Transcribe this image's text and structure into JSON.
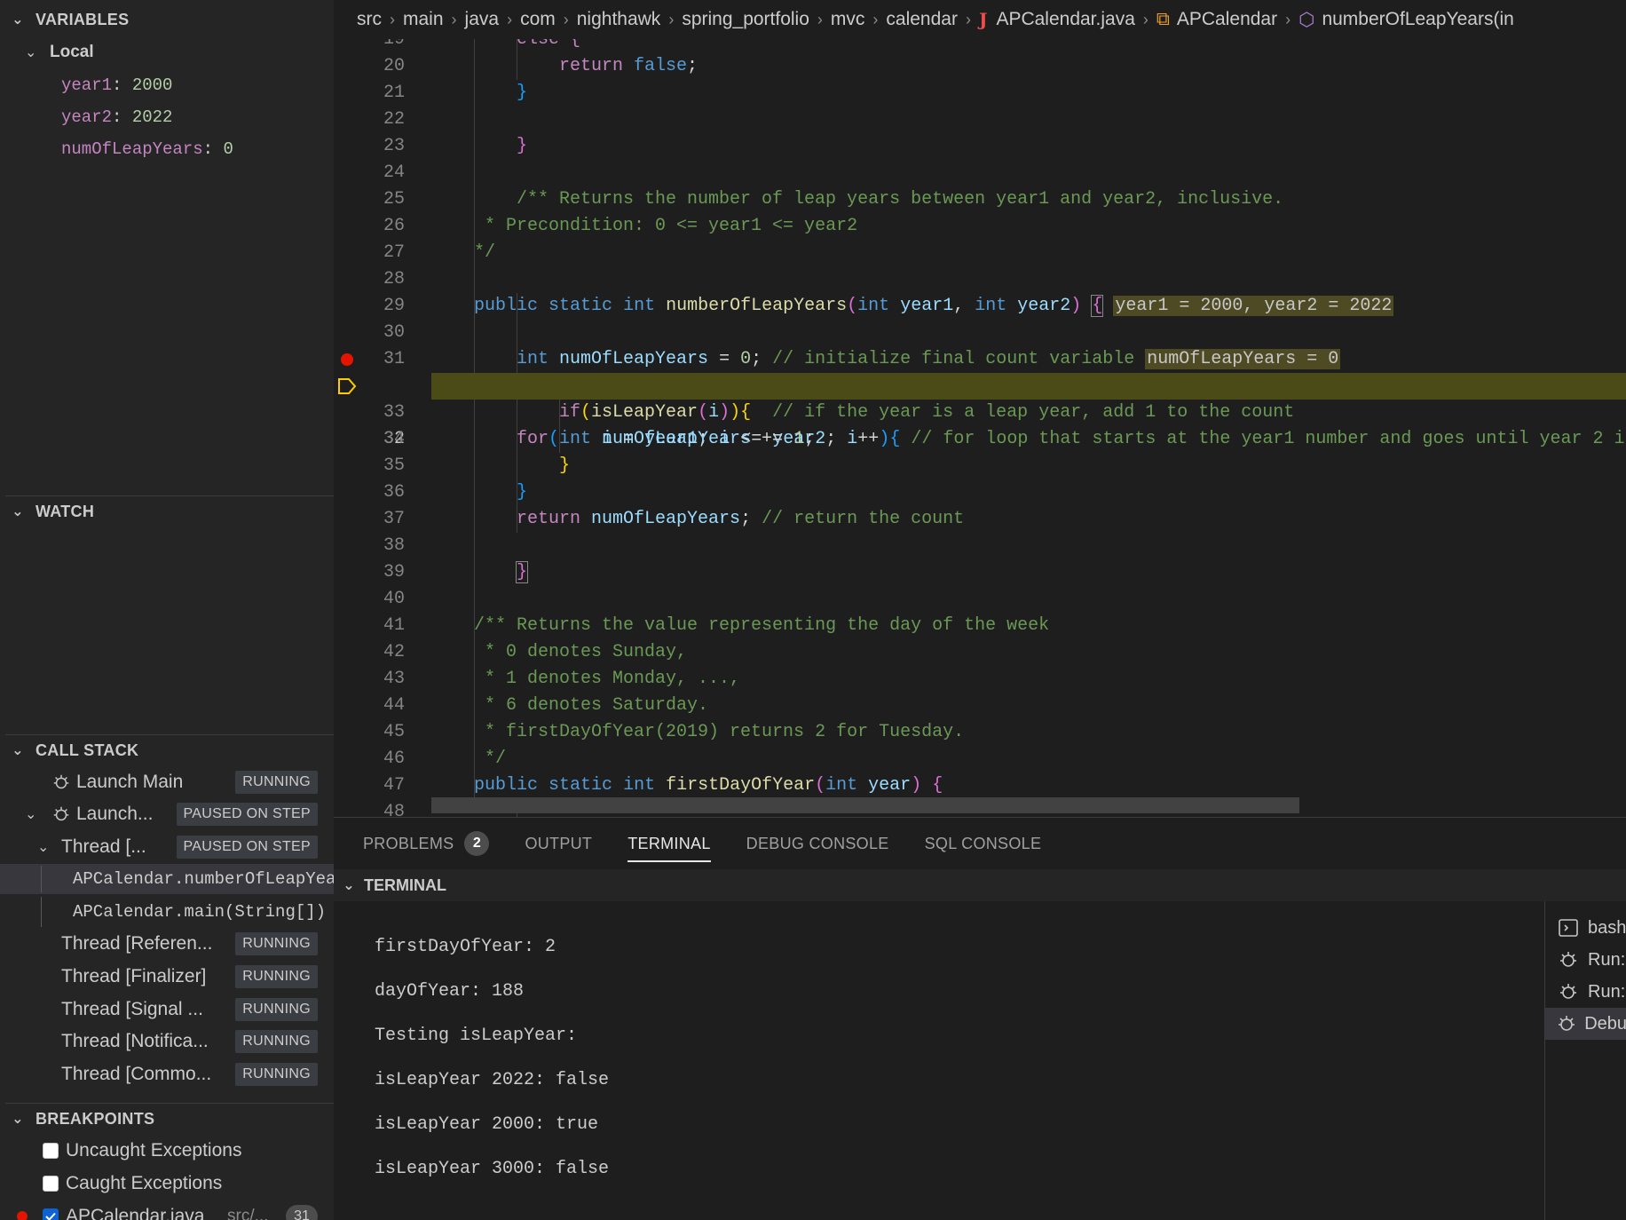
{
  "sidebar": {
    "variables": {
      "title": "VARIABLES",
      "scope": "Local",
      "vars": [
        {
          "name": "year1",
          "value": "2000"
        },
        {
          "name": "year2",
          "value": "2022"
        },
        {
          "name": "numOfLeapYears",
          "value": "0"
        }
      ]
    },
    "watch": {
      "title": "WATCH"
    },
    "call_stack": {
      "title": "CALL STACK",
      "items": [
        {
          "label": "Launch Main",
          "status": "RUNNING"
        },
        {
          "label": "Launch...",
          "status": "PAUSED ON STEP"
        },
        {
          "label": "Thread [...",
          "status": "PAUSED ON STEP"
        },
        {
          "label": "APCalendar.numberOfLeapYear"
        },
        {
          "label": "APCalendar.main(String[])"
        },
        {
          "label": "Thread [Referen...",
          "status": "RUNNING"
        },
        {
          "label": "Thread [Finalizer]",
          "status": "RUNNING"
        },
        {
          "label": "Thread [Signal ...",
          "status": "RUNNING"
        },
        {
          "label": "Thread [Notifica...",
          "status": "RUNNING"
        },
        {
          "label": "Thread [Commo...",
          "status": "RUNNING"
        }
      ]
    },
    "breakpoints": {
      "title": "BREAKPOINTS",
      "items": [
        {
          "label": "Uncaught Exceptions",
          "checked": false
        },
        {
          "label": "Caught Exceptions",
          "checked": false
        },
        {
          "label": "APCalendar.java",
          "path": "src/...",
          "line": "31",
          "checked": true
        }
      ]
    }
  },
  "breadcrumb": [
    "src",
    "main",
    "java",
    "com",
    "nighthawk",
    "spring_portfolio",
    "mvc",
    "calendar",
    "APCalendar.java",
    "APCalendar",
    "numberOfLeapYears(in"
  ],
  "editor": {
    "line_numbers": [
      "19",
      "20",
      "21",
      "22",
      "23",
      "24",
      "25",
      "26",
      "27",
      "28",
      "29",
      "30",
      "31",
      "32",
      "33",
      "34",
      "35",
      "36",
      "37",
      "38",
      "39",
      "40",
      "41",
      "42",
      "43",
      "44",
      "45",
      "46",
      "47",
      "48"
    ],
    "breakpoint_line": "31",
    "current_line": "32",
    "code": {
      "l19": "else {",
      "l20_kw": "return",
      "l20_val": "false",
      "l25": "/** Returns the number of leap years between year1 and year2, inclusive.",
      "l26": " * Precondition: 0 <= year1 <= year2",
      "l27": "*/",
      "l29_inline": "year1 = 2000, year2 = 2022",
      "l31_comment": "// initialize final count variable",
      "l31_inline": "numOfLeapYears = 0",
      "l32_comment": "// for loop that starts at the year1 number and goes until year 2 i",
      "l33_comment": "// if the year is a leap year, add 1 to the count",
      "l37_comment": "// return the count",
      "l41": "/** Returns the value representing the day of the week",
      "l42": " * 0 denotes Sunday,",
      "l43": " * 1 denotes Monday, ...,",
      "l44": " * 6 denotes Saturday.",
      "l45": " * firstDayOfYear(2019) returns 2 for Tuesday.",
      "l46": " */"
    }
  },
  "panel": {
    "tabs": [
      {
        "label": "PROBLEMS",
        "badge": "2"
      },
      {
        "label": "OUTPUT"
      },
      {
        "label": "TERMINAL"
      },
      {
        "label": "DEBUG CONSOLE"
      },
      {
        "label": "SQL CONSOLE"
      }
    ],
    "active_tab": "TERMINAL",
    "terminal_title": "TERMINAL",
    "terminal_lines": [
      "firstDayOfYear: 2",
      "dayOfYear: 188",
      "Testing isLeapYear:",
      "isLeapYear 2022: false",
      "isLeapYear 2000: true",
      "isLeapYear 3000: false"
    ],
    "terminal_list": [
      {
        "label": "bash",
        "icon": "terminal-icon"
      },
      {
        "label": "Run:",
        "icon": "debug-icon"
      },
      {
        "label": "Run:",
        "icon": "debug-icon"
      },
      {
        "label": "Debu",
        "icon": "debug-icon"
      }
    ]
  },
  "colors": {
    "accent": "#0e63d4",
    "breakpoint": "#e51400",
    "current_line_bg": "#4b4b18"
  }
}
